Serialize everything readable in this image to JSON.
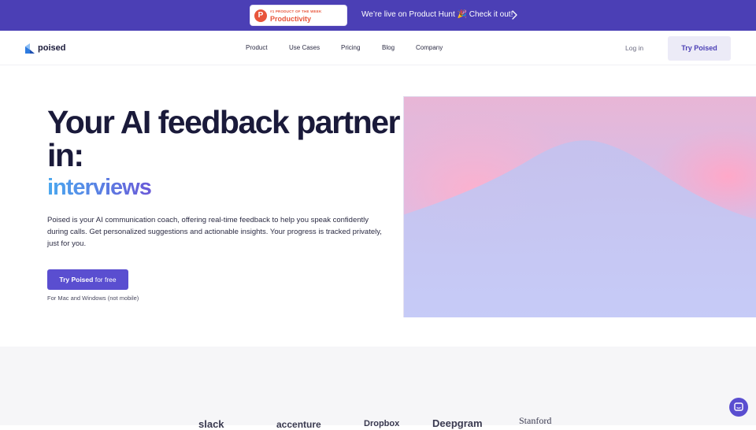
{
  "announcement": {
    "badge_small": "#1 PRODUCT OF THE WEEK",
    "badge_title": "Productivity",
    "text": "We’re live on Product Hunt 🎉 Check it out!"
  },
  "header": {
    "logo_text": "poised",
    "nav": [
      "Product",
      "Use Cases",
      "Pricing",
      "Blog",
      "Company"
    ],
    "login": "Log in",
    "try_button": "Try Poised"
  },
  "hero": {
    "title": "Your AI feedback partner in:",
    "rotating_word": "interviews",
    "description": "Poised is your AI communication coach, offering real-time feedback to help you speak confidently during calls. Get personalized suggestions and actionable insights. Your progress is tracked privately, just for you.",
    "cta_bold": "Try Poised",
    "cta_rest": " for free",
    "note": "For Mac and Windows (not mobile)"
  },
  "logos": [
    "slack",
    "accenture",
    "Dropbox",
    "Deepgram",
    "Stanford"
  ],
  "colors": {
    "brand": "#4b3fb5",
    "cta": "#5a4ed0",
    "heading": "#1a1a3a"
  }
}
